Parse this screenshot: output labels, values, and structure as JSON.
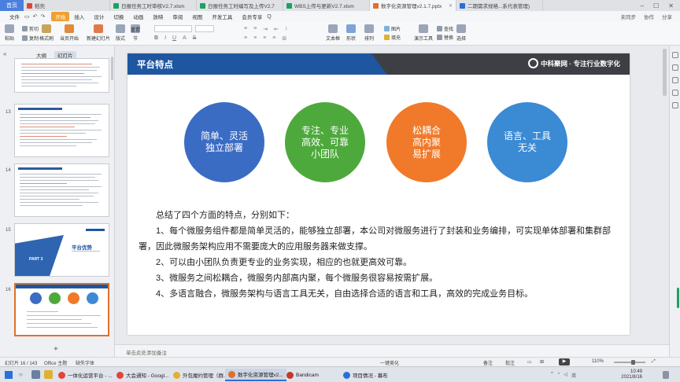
{
  "tabs": {
    "home": "首页",
    "items": [
      {
        "label": "稻壳",
        "color": "#e0453a",
        "active": false
      },
      {
        "label": "日报任务工时审核V2.7.xlsm",
        "color": "#1aa260",
        "active": false
      },
      {
        "label": "日报任务工时编写及上传V2.7",
        "color": "#1aa260",
        "active": false
      },
      {
        "label": "WBS上传与更新V2.7.xlsm",
        "color": "#1aa260",
        "active": false
      },
      {
        "label": "数字化资源管理v2.1.7.pptx",
        "color": "#e0702a",
        "active": true
      },
      {
        "label": "二期需求规格...系代表管理)",
        "color": "#2a6fd6",
        "active": false
      }
    ]
  },
  "menu": {
    "file": "文件",
    "items": [
      "开始",
      "插入",
      "设计",
      "切换",
      "动画",
      "放映",
      "审阅",
      "视图",
      "开发工具",
      "会员专享"
    ],
    "active": "开始",
    "search": "Q",
    "right": [
      "未同步",
      "协作",
      "分享"
    ]
  },
  "ribbon": {
    "paste": "粘贴",
    "cut": "剪切",
    "copy": "复制",
    "format_painter": "格式刷",
    "from_current": "当页开始",
    "new_slide": "新建幻灯片",
    "layout": "版式",
    "section": "节",
    "reset": "重置",
    "textbox": "文本框",
    "shape": "形状",
    "arrange": "排列",
    "picture": "图片",
    "fill": "填充",
    "outline": "轮廓",
    "presentation_tool": "演示工具",
    "find": "查找",
    "replace": "替换",
    "select": "选择"
  },
  "left_panel": {
    "tabs": [
      "大纲",
      "幻灯片"
    ],
    "active_tab": "幻灯片",
    "slide_numbers": [
      "13",
      "14",
      "15",
      "16"
    ],
    "thumb15_title": "平台优势",
    "thumb15_part": "PART 3",
    "add_slide": "+"
  },
  "slide": {
    "title": "平台特点",
    "brand": "中科聚网 · 专注行业数字化",
    "circles": [
      {
        "text": "简单、灵活\n独立部署",
        "color": "#3b6cc4"
      },
      {
        "text": "专注、专业\n高效、可靠\n小团队",
        "color": "#4ea93c"
      },
      {
        "text": "松耦合\n高内聚\n易扩展",
        "color": "#f07a2a"
      },
      {
        "text": "语言、工具\n无关",
        "color": "#3b8ad4"
      }
    ],
    "summary_intro": "总结了四个方面的特点，分别如下：",
    "points": [
      "1、每个微服务组件都是简单灵活的，能够独立部署，本公司对微服务进行了封装和业务编排，可实现单体部署和集群部署，因此微服务架构应用不需要庞大的应用服务器来做支撑。",
      "2、可以由小团队负责更专业的业务实现，相应的也就更高效可靠。",
      "3、微服务之间松耦合，微服务内部高内聚，每个微服务很容易按需扩展。",
      "4、多语言融合，微服务架构与语言工具无关，自由选择合适的语言和工具，高效的完成业务目标。"
    ]
  },
  "notes_placeholder": "单击此处添加备注",
  "status": {
    "slide_pos": "幻灯片 16 / 143",
    "theme": "Office 主题",
    "font_missing": "缺失字体",
    "notes": "备注",
    "comments": "批注",
    "beautify": "一键美化",
    "zoom": "110%"
  },
  "taskbar": {
    "search": "○",
    "apps": [
      {
        "label": "一体化运营平台 - ...",
        "color": "#e0453a",
        "active": false
      },
      {
        "label": "大会通知 - Googl...",
        "color": "#e0453a",
        "active": false
      },
      {
        "label": "外包履约管理（群...",
        "color": "#e0b030",
        "active": false
      },
      {
        "label": "数字化资源管理v2...",
        "color": "#e0702a",
        "active": true
      },
      {
        "label": "Bandicam",
        "color": "#c0392b",
        "active": false
      },
      {
        "label": "项目情况 - 幕布",
        "color": "#2a6fd6",
        "active": false
      }
    ],
    "tray_lang": "英",
    "time": "10:49",
    "date": "2021/8/16"
  },
  "colors": {
    "header_blue": "#1e56a0",
    "header_dark": "#3d3f44",
    "accent_orange": "#e0702a"
  }
}
